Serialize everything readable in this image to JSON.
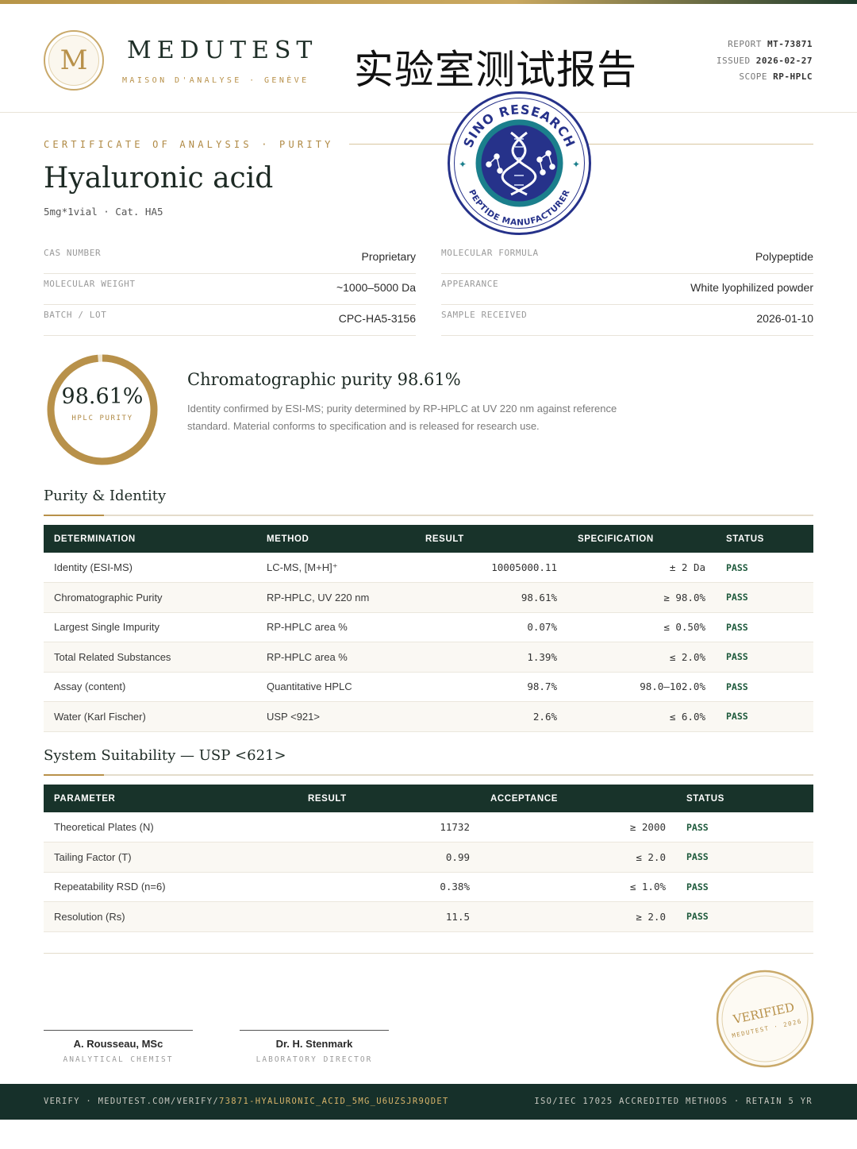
{
  "brand": {
    "logo_letter": "M",
    "name": "MEDUTEST",
    "subtitle": "MAISON D'ANALYSE · GENÈVE"
  },
  "doc_title_cn": "实验室测试报告",
  "meta": {
    "report_label": "REPORT",
    "report_value": "MT-73871",
    "issued_label": "ISSUED",
    "issued_value": "2026-02-27",
    "scope_label": "SCOPE",
    "scope_value": "RP-HPLC"
  },
  "certificate": {
    "eyebrow": "CERTIFICATE OF ANALYSIS · PURITY",
    "product_name": "Hyaluronic acid",
    "product_sub": "5mg*1vial  ·  Cat. HA5"
  },
  "seal": {
    "top_text": "SINO RESEARCH",
    "bottom_text": "PEPTIDE MANUFACTURER"
  },
  "properties": {
    "left": [
      {
        "key": "CAS NUMBER",
        "value": "Proprietary"
      },
      {
        "key": "MOLECULAR WEIGHT",
        "value": "~1000–5000 Da"
      },
      {
        "key": "BATCH / LOT",
        "value": "CPC-HA5-3156"
      }
    ],
    "right": [
      {
        "key": "MOLECULAR FORMULA",
        "value": "Polypeptide"
      },
      {
        "key": "APPEARANCE",
        "value": "White lyophilized powder"
      },
      {
        "key": "SAMPLE RECEIVED",
        "value": "2026-01-10"
      }
    ]
  },
  "purity": {
    "value_text": "98.61%",
    "fraction": 0.9861,
    "ring_label": "HPLC PURITY",
    "heading": "Chromatographic purity 98.61%",
    "description": "Identity confirmed by ESI-MS; purity determined by RP-HPLC at UV 220 nm against reference standard. Material conforms to specification and is released for research use."
  },
  "purity_identity": {
    "title": "Purity & Identity",
    "headers": [
      "DETERMINATION",
      "METHOD",
      "RESULT",
      "SPECIFICATION",
      "STATUS"
    ],
    "rows": [
      [
        "Identity (ESI-MS)",
        "LC-MS, [M+H]⁺",
        "10005000.11",
        "± 2 Da",
        "PASS"
      ],
      [
        "Chromatographic Purity",
        "RP-HPLC, UV 220 nm",
        "98.61%",
        "≥ 98.0%",
        "PASS"
      ],
      [
        "Largest Single Impurity",
        "RP-HPLC area %",
        "0.07%",
        "≤ 0.50%",
        "PASS"
      ],
      [
        "Total Related Substances",
        "RP-HPLC area %",
        "1.39%",
        "≤ 2.0%",
        "PASS"
      ],
      [
        "Assay (content)",
        "Quantitative HPLC",
        "98.7%",
        "98.0–102.0%",
        "PASS"
      ],
      [
        "Water (Karl Fischer)",
        "USP <921>",
        "2.6%",
        "≤ 6.0%",
        "PASS"
      ]
    ]
  },
  "system_suitability": {
    "title": "System Suitability — USP <621>",
    "headers": [
      "PARAMETER",
      "RESULT",
      "ACCEPTANCE",
      "STATUS"
    ],
    "rows": [
      [
        "Theoretical Plates (N)",
        "11732",
        "≥ 2000",
        "PASS"
      ],
      [
        "Tailing Factor (T)",
        "0.99",
        "≤ 2.0",
        "PASS"
      ],
      [
        "Repeatability RSD (n=6)",
        "0.38%",
        "≤ 1.0%",
        "PASS"
      ],
      [
        "Resolution (Rs)",
        "11.5",
        "≥ 2.0",
        "PASS"
      ]
    ]
  },
  "signatures": [
    {
      "name": "A. Rousseau, MSc",
      "role": "ANALYTICAL CHEMIST"
    },
    {
      "name": "Dr. H. Stenmark",
      "role": "LABORATORY DIRECTOR"
    }
  ],
  "stamp": {
    "main": "VERIFIED",
    "sub": "MEDUTEST · 2026"
  },
  "footer": {
    "left_prefix": "VERIFY · MEDUTEST.COM/VERIFY/",
    "left_code": "73871-HYALURONIC_ACID_5MG_U6UZSJR9QDET",
    "right": "ISO/IEC 17025 ACCREDITED METHODS · RETAIN 5 YR"
  },
  "colors": {
    "gold": "#b8914a",
    "dark_green": "#18332a",
    "pass_green": "#1e5a3c",
    "seal_navy": "#26328a",
    "seal_teal": "#1b7f8c"
  }
}
